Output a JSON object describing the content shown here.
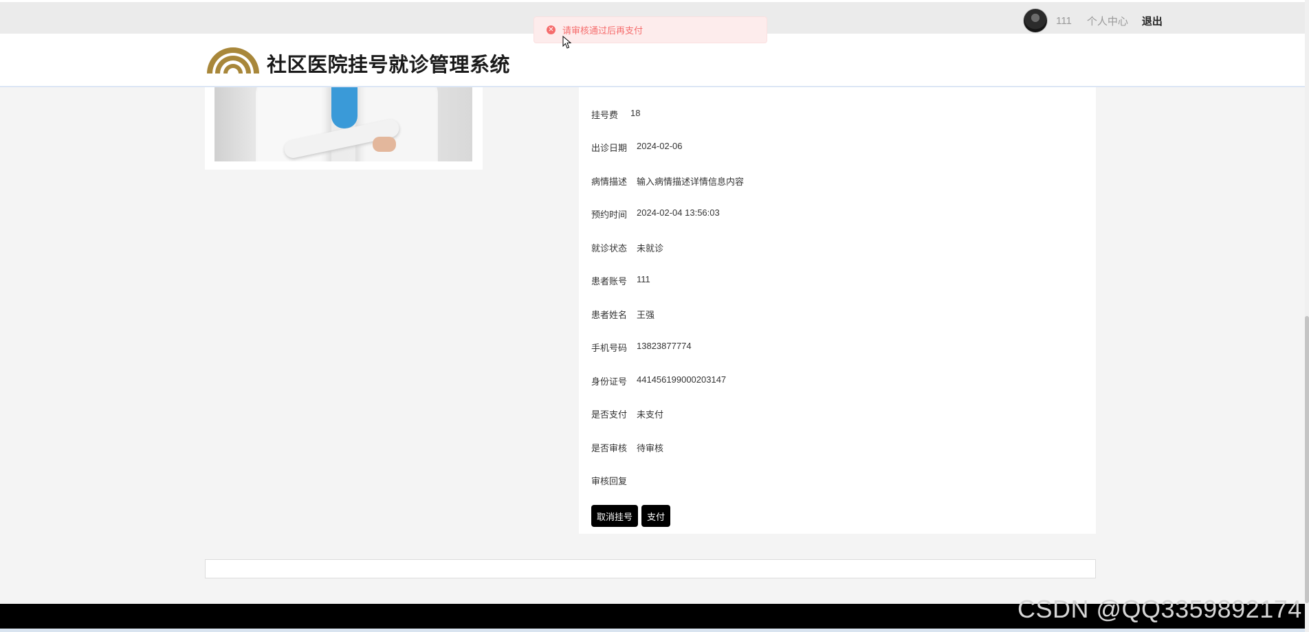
{
  "topbar": {
    "username": "111",
    "personal_center": "个人中心",
    "logout": "退出"
  },
  "toast": {
    "message": "请审核通过后再支付",
    "icon": "error-circle-icon",
    "color": "#f56c6c"
  },
  "header": {
    "site_title": "社区医院挂号就诊管理系统",
    "logo_color": "#a8873a"
  },
  "detail": {
    "fields": [
      {
        "label": "挂号费",
        "value": "18"
      },
      {
        "label": "出诊日期",
        "value": "2024-02-06"
      },
      {
        "label": "病情描述",
        "value": "输入病情描述详情信息内容"
      },
      {
        "label": "预约时间",
        "value": "2024-02-04 13:56:03"
      },
      {
        "label": "就诊状态",
        "value": "未就诊"
      },
      {
        "label": "患者账号",
        "value": "111"
      },
      {
        "label": "患者姓名",
        "value": "王强"
      },
      {
        "label": "手机号码",
        "value": "13823877774"
      },
      {
        "label": "身份证号",
        "value": "441456199000203147"
      },
      {
        "label": "是否支付",
        "value": "未支付"
      },
      {
        "label": "是否审核",
        "value": "待审核"
      },
      {
        "label": "审核回复",
        "value": ""
      }
    ],
    "buttons": {
      "cancel": "取消挂号",
      "pay": "支付"
    }
  },
  "watermark": "CSDN @QQ3359892174"
}
